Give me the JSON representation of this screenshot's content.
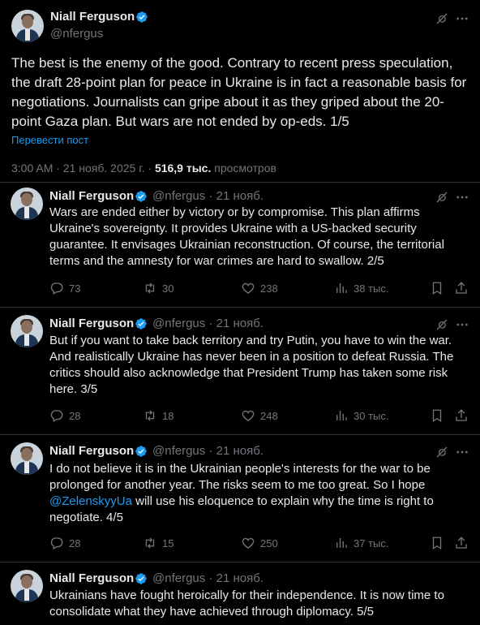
{
  "author": {
    "name": "Niall Ferguson",
    "handle": "@nfergus",
    "verified_color": "#1d9bf0"
  },
  "main_tweet": {
    "text": "The best is the enemy of the good. Contrary to recent press speculation, the draft 28-point plan for peace in Ukraine is in fact a reasonable basis for negotiations. Journalists can gripe about it as they griped about the 20-point Gaza plan. But wars are not ended by op-eds. 1/5",
    "translate_label": "Перевести пост",
    "timestamp": "3:00 AM · 21 нояб. 2025 г. · ",
    "views_count": "516,9 тыс.",
    "views_label": " просмотров"
  },
  "replies": [
    {
      "date": "· 21 нояб.",
      "text": "Wars are ended either by victory or by compromise. This plan affirms Ukraine's sovereignty. It provides Ukraine with a US-backed security guarantee. It envisages Ukrainian reconstruction. Of course, the territorial terms and the amnesty for war crimes are hard to swallow. 2/5",
      "replies": "73",
      "reposts": "30",
      "likes": "238",
      "views": "38 тыс."
    },
    {
      "date": "· 21 нояб.",
      "text": "But if you want to take back territory and try Putin, you have to win the war. And realistically Ukraine has never been in a position to defeat Russia. The critics should also acknowledge that President Trump has taken some risk here. 3/5",
      "replies": "28",
      "reposts": "18",
      "likes": "248",
      "views": "30 тыс."
    },
    {
      "date": "· 21 нояб.",
      "text_before": "I do not believe it is in the Ukrainian people's interests for the war to be prolonged for another year. The risks seem to me too great. So I hope ",
      "mention": "@ZelenskyyUa",
      "text_after": " will use his eloquence to explain why the time is right to negotiate. 4/5",
      "replies": "28",
      "reposts": "15",
      "likes": "250",
      "views": "37 тыс."
    },
    {
      "date": "· 21 нояб.",
      "text": "Ukrainians have fought heroically for their independence. It is now time to consolidate what they have achieved through diplomacy. 5/5"
    }
  ]
}
